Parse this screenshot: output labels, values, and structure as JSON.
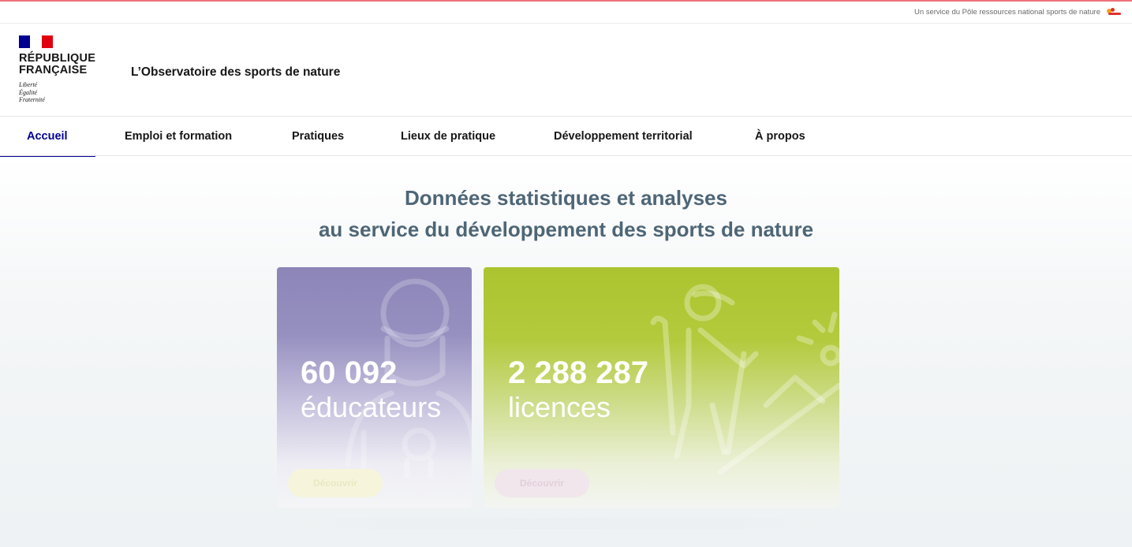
{
  "service_bar": {
    "text": "Un service du Pôle ressources national sports de nature",
    "logo_icon": "pole-ressources-logo"
  },
  "header": {
    "republic_line1": "RÉPUBLIQUE",
    "republic_line2": "FRANÇAISE",
    "motto_1": "Liberté",
    "motto_2": "Égalité",
    "motto_3": "Fraternité",
    "site_title": "L’Observatoire des sports de nature"
  },
  "nav": {
    "items": [
      {
        "label": "Accueil",
        "active": true
      },
      {
        "label": "Emploi et formation"
      },
      {
        "label": "Pratiques"
      },
      {
        "label": "Lieux de pratique"
      },
      {
        "label": "Développement territorial"
      },
      {
        "label": "À propos"
      }
    ]
  },
  "hero": {
    "title_line1": "Données statistiques et analyses",
    "title_line2": "au service du développement des sports de nature"
  },
  "cards": [
    {
      "number": "60 092",
      "label": "éducateurs",
      "button": "Découvrir",
      "color": "#8d85b8",
      "icon": "educator-icon"
    },
    {
      "number": "2 288 287",
      "label": "licences",
      "button": "Découvrir",
      "color": "#acc42f",
      "icon": "hiker-icon"
    }
  ],
  "colors": {
    "brand_blue": "#000091",
    "brand_red": "#e1000f",
    "title_slate": "#4e6676"
  }
}
